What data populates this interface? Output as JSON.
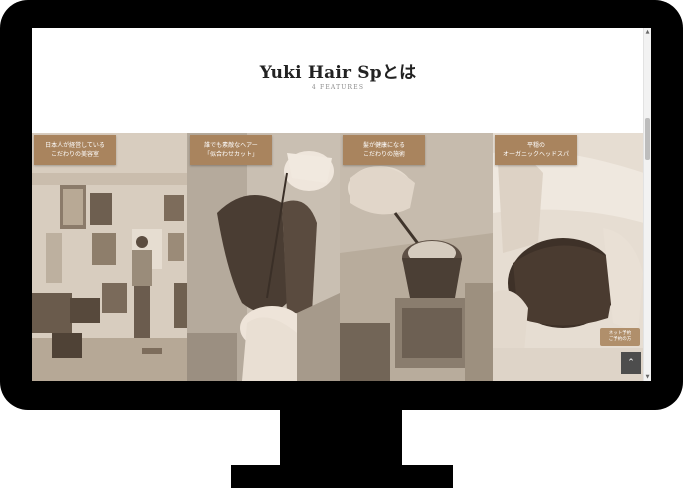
{
  "header": {
    "title": "Yuki Hair Spとは",
    "subtitle": "4 FEATURES"
  },
  "features": [
    {
      "label_line1": "日本人が経営している",
      "label_line2": "こだわりの美容室",
      "image": "salon-interior-photo"
    },
    {
      "label_line1": "誰でも素敵なヘアー",
      "label_line2": "「似合わせカット」",
      "image": "haircut-photo"
    },
    {
      "label_line1": "髪が健康になる",
      "label_line2": "こだわりの施術",
      "image": "hair-color-bowl-photo"
    },
    {
      "label_line1": "平穏の",
      "label_line2": "オーガニックヘッドスパ",
      "image": "head-spa-photo"
    }
  ],
  "floating_button": {
    "line1": "ネット予約",
    "line2": "ご予約の方"
  },
  "scroll_top": {
    "icon": "chevron-up-icon",
    "glyph": "⌃"
  },
  "colors": {
    "accent": "#a9845e",
    "monitor": "#000000",
    "dark_button": "#4d4d4d"
  }
}
